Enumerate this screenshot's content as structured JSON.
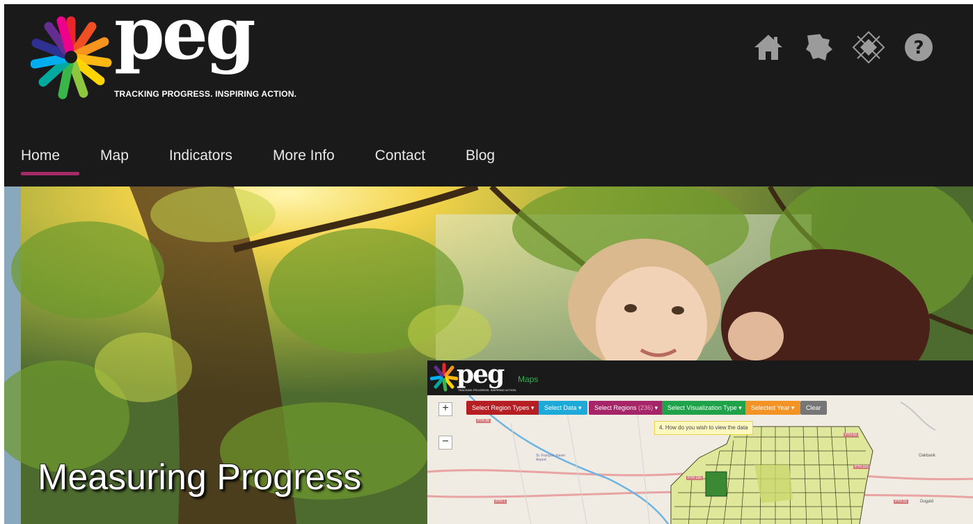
{
  "header": {
    "logo_text": "peg",
    "tagline": "TRACKING PROGRESS. INSPIRING ACTION.",
    "icons": [
      "home-icon",
      "manitoba-map-icon",
      "star-blanket-icon",
      "help-icon"
    ]
  },
  "nav": {
    "items": [
      {
        "label": "Home",
        "active": true
      },
      {
        "label": "Map"
      },
      {
        "label": "Indicators"
      },
      {
        "label": "More Info"
      },
      {
        "label": "Contact"
      },
      {
        "label": "Blog"
      }
    ]
  },
  "hero": {
    "tagline": "Measuring Progress"
  },
  "maps_preview": {
    "logo_text": "peg",
    "logo_tag": "TRACKING PROGRESS. INSPIRING ACTION.",
    "title": "Maps",
    "buttons": [
      {
        "label": "Select Region Types",
        "color": "#b51f24"
      },
      {
        "label": "Select Data",
        "color": "#1eaad9"
      },
      {
        "label": "Select Regions",
        "count": "(236)",
        "color": "#a52568"
      },
      {
        "label": "Select Visualization Type",
        "color": "#1fa34a"
      },
      {
        "label": "Selected Year",
        "color": "#f39324"
      },
      {
        "label": "Clear",
        "color": "#767676"
      }
    ],
    "tooltip": "4. How do you wish to view the data",
    "zoom_in": "+",
    "zoom_out": "−",
    "place_labels": [
      "St. François Xavier Airport",
      "Oakbank",
      "Dugald",
      "PTH 26",
      "PTH 1",
      "PTH 101",
      "PTH 15",
      "PTH 59",
      "PTH 190"
    ]
  }
}
